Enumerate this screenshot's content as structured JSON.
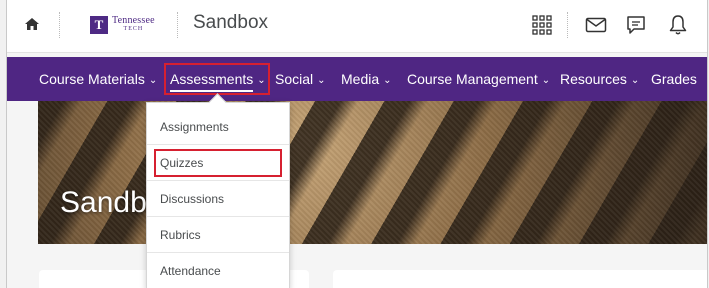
{
  "topbar": {
    "logo_line1": "Tennessee",
    "logo_line2": "TECH",
    "logo_mark": "T",
    "site_title": "Sandbox",
    "icons": [
      "home-icon",
      "waffle-icon",
      "email-icon",
      "chat-icon",
      "bell-icon"
    ]
  },
  "nav": {
    "items": [
      {
        "label": "Course Materials",
        "chevron": true
      },
      {
        "label": "Assessments",
        "chevron": true,
        "active": true
      },
      {
        "label": "Social",
        "chevron": true
      },
      {
        "label": "Media",
        "chevron": true
      },
      {
        "label": "Course Management",
        "chevron": true
      },
      {
        "label": "Resources",
        "chevron": true
      },
      {
        "label": "Grades",
        "chevron": false
      }
    ],
    "chevron_glyph": "⌄"
  },
  "banner": {
    "title": "Sandbox"
  },
  "dropdown": {
    "items": [
      {
        "label": "Assignments"
      },
      {
        "label": "Quizzes",
        "highlighted": true
      },
      {
        "label": "Discussions"
      },
      {
        "label": "Rubrics"
      },
      {
        "label": "Attendance"
      }
    ]
  },
  "colors": {
    "nav_bg": "#4f2683",
    "highlight": "#d62030",
    "brand": "#4e2a84"
  }
}
